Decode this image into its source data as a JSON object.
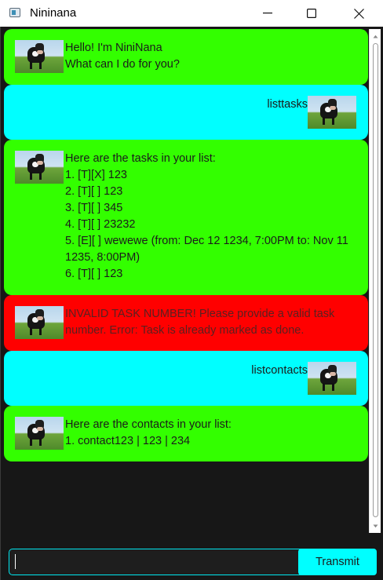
{
  "window": {
    "title": "Nininana",
    "minimize_icon": "minimize-icon",
    "maximize_icon": "maximize-icon",
    "close_icon": "close-icon"
  },
  "colors": {
    "bot_bubble": "#33ff00",
    "user_bubble": "#00ffff",
    "error_bubble": "#ff0000",
    "background": "#171717",
    "accent": "#00ffff"
  },
  "messages": [
    {
      "sender": "bot",
      "lines": [
        "Hello! I'm NiniNana",
        "What can I do for you?"
      ]
    },
    {
      "sender": "user",
      "lines": [
        "listtasks"
      ]
    },
    {
      "sender": "bot",
      "lines": [
        "Here are the tasks in your list:",
        "1. [T][X] 123",
        "2. [T][ ] 123",
        "3. [T][ ] 345",
        "4. [T][ ] 23232",
        "5. [E][ ] wewewe (from: Dec 12 1234, 7:00PM to: Nov 11",
        "1235, 8:00PM)",
        "6. [T][ ] 123"
      ]
    },
    {
      "sender": "error",
      "lines": [
        "INVALID TASK NUMBER! Please provide a valid task",
        "number. Error: Task is already marked as done."
      ]
    },
    {
      "sender": "user",
      "lines": [
        "listcontacts"
      ]
    },
    {
      "sender": "bot",
      "lines": [
        "Here are the contacts in your list:",
        "1. contact123 | 123 | 234"
      ]
    }
  ],
  "input": {
    "value": "",
    "placeholder": ""
  },
  "transmit_button": {
    "label": "Transmit"
  }
}
